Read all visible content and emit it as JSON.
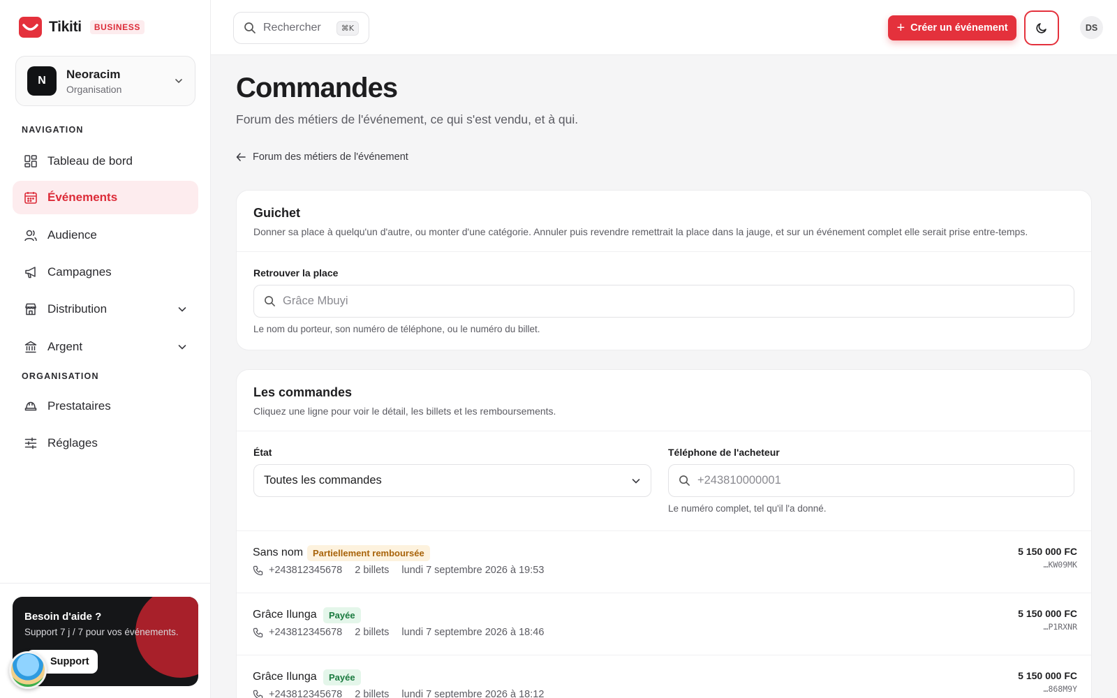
{
  "brand": {
    "name": "Tikiti",
    "badge": "BUSINESS"
  },
  "org": {
    "initial": "N",
    "name": "Neoracim",
    "subtitle": "Organisation"
  },
  "sidebar": {
    "nav_title": "NAVIGATION",
    "org_title": "ORGANISATION",
    "items": [
      {
        "label": "Tableau de bord",
        "icon": "dashboard-icon"
      },
      {
        "label": "Événements",
        "icon": "calendar-icon",
        "active": true
      },
      {
        "label": "Audience",
        "icon": "users-icon"
      },
      {
        "label": "Campagnes",
        "icon": "megaphone-icon"
      },
      {
        "label": "Distribution",
        "icon": "store-icon",
        "expandable": true
      },
      {
        "label": "Argent",
        "icon": "bank-icon",
        "expandable": true
      }
    ],
    "org_items": [
      {
        "label": "Prestataires",
        "icon": "hardhat-icon"
      },
      {
        "label": "Réglages",
        "icon": "sliders-icon"
      }
    ],
    "help": {
      "title": "Besoin d'aide ?",
      "subtitle": "Support 7 j / 7 pour vos événements.",
      "button": "Support"
    }
  },
  "topbar": {
    "search_placeholder": "Rechercher",
    "search_shortcut": "⌘K",
    "create_label": "Créer un événement",
    "user_initials": "DS"
  },
  "page": {
    "title": "Commandes",
    "subtitle": "Forum des métiers de l'événement, ce qui s'est vendu, et à qui.",
    "back_label": "Forum des métiers de l'événement"
  },
  "guichet": {
    "title": "Guichet",
    "description": "Donner sa place à quelqu'un d'autre, ou monter d'une catégorie. Annuler puis revendre remettrait la place dans la jauge, et sur un événement complet elle serait prise entre-temps.",
    "field_label": "Retrouver la place",
    "placeholder": "Grâce Mbuyi",
    "hint": "Le nom du porteur, son numéro de téléphone, ou le numéro du billet."
  },
  "orders": {
    "title": "Les commandes",
    "description": "Cliquez une ligne pour voir le détail, les billets et les remboursements.",
    "state_label": "État",
    "state_value": "Toutes les commandes",
    "phone_label": "Téléphone de l'acheteur",
    "phone_placeholder": "+243810000001",
    "phone_hint": "Le numéro complet, tel qu'il l'a donné.",
    "rows": [
      {
        "name": "Sans nom",
        "status": "Partiellement remboursée",
        "status_kind": "partial",
        "phone": "+243812345678",
        "tickets": "2 billets",
        "date": "lundi 7 septembre 2026 à 19:53",
        "amount": "5 150 000 FC",
        "ref": "…KW09MK"
      },
      {
        "name": "Grâce Ilunga",
        "status": "Payée",
        "status_kind": "paid",
        "phone": "+243812345678",
        "tickets": "2 billets",
        "date": "lundi 7 septembre 2026 à 18:46",
        "amount": "5 150 000 FC",
        "ref": "…P1RXNR"
      },
      {
        "name": "Grâce Ilunga",
        "status": "Payée",
        "status_kind": "paid",
        "phone": "+243812345678",
        "tickets": "2 billets",
        "date": "lundi 7 septembre 2026 à 18:12",
        "amount": "5 150 000 FC",
        "ref": "…868M9Y"
      }
    ]
  },
  "colors": {
    "accent": "#e4313c",
    "accent_soft": "#fdecee",
    "dark": "#151618"
  }
}
